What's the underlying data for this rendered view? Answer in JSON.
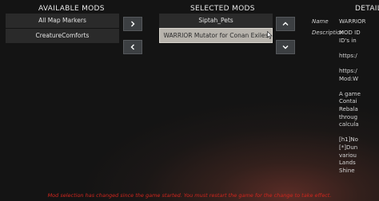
{
  "headers": {
    "available": "AVAILABLE MODS",
    "selected": "SELECTED MODS",
    "details": "DETAIL"
  },
  "available_mods": [
    "All Map Markers",
    "CreatureComforts"
  ],
  "selected_mods": [
    "Siptah_Pets",
    "WARRIOR Mutator for Conan Exiles"
  ],
  "details": {
    "name_label": "Name",
    "description_label": "Description",
    "name_value": "WARRIOR",
    "description_lines": [
      "MOD ID",
      "ID's in",
      "",
      "https:/",
      "",
      "https:/",
      "Mod:W",
      "",
      "A game",
      "Contai",
      "Rebala",
      "throug",
      "calcula",
      "",
      "[h1]No",
      "[*]Dun",
      "variou",
      "Lands",
      "Shine"
    ]
  },
  "footer_message": "Mod selection has changed since the game started.  You must restart the game for the change to take effect."
}
